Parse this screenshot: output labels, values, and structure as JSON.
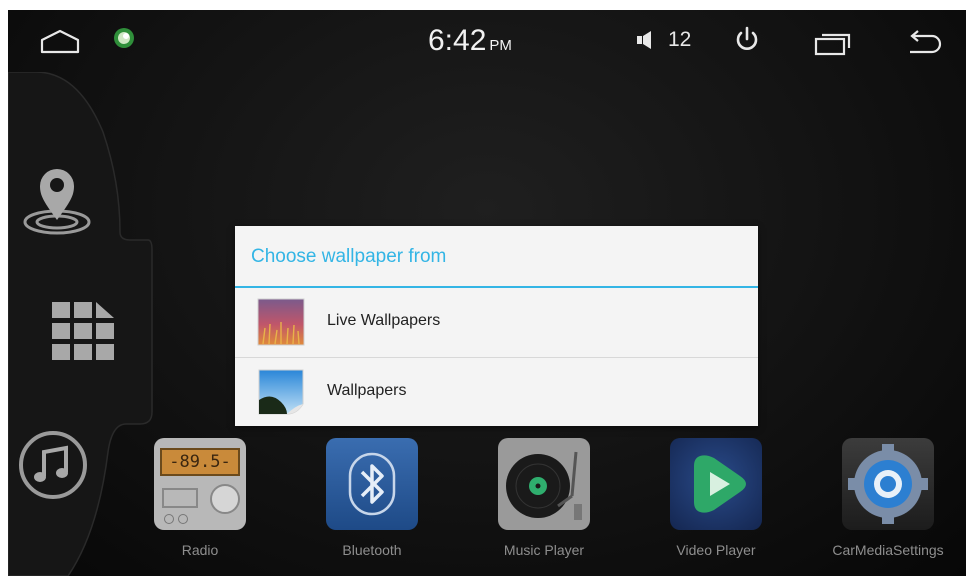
{
  "status_bar": {
    "time": "6:42",
    "ampm": "PM",
    "volume": "12",
    "icons": [
      "home-icon",
      "app-badge-icon",
      "volume-icon",
      "power-icon",
      "recents-icon",
      "back-icon"
    ]
  },
  "rail": {
    "icons": [
      "navigation-icon",
      "app-grid-icon",
      "music-icon"
    ]
  },
  "dock": [
    {
      "label": "Radio",
      "icon": "radio-icon",
      "display": "-89.5-"
    },
    {
      "label": "Bluetooth",
      "icon": "bluetooth-icon"
    },
    {
      "label": "Music Player",
      "icon": "turntable-icon"
    },
    {
      "label": "Video Player",
      "icon": "play-icon"
    },
    {
      "label": "CarMediaSettings",
      "icon": "gear-icon"
    }
  ],
  "dialog": {
    "title": "Choose wallpaper from",
    "options": [
      {
        "label": "Live Wallpapers",
        "icon": "live-wallpapers-icon"
      },
      {
        "label": "Wallpapers",
        "icon": "wallpapers-icon"
      }
    ]
  },
  "colors": {
    "accent": "#33b5e5",
    "background": "#0d0d0d",
    "dialog_bg": "#f4f4f4"
  }
}
